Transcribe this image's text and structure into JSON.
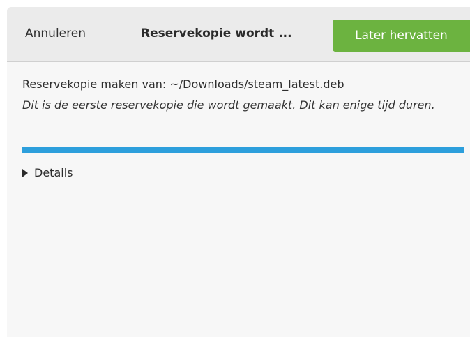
{
  "header": {
    "cancel_label": "Annuleren",
    "title": "Reservekopie wordt ...",
    "resume_label": "Later hervatten"
  },
  "main": {
    "source_line": "Reservekopie maken van: ~/Downloads/steam_latest.deb",
    "note": "Dit is de eerste reservekopie die wordt gemaakt. Dit kan enige tijd duren.",
    "progress_percent": 100,
    "details_label": "Details"
  },
  "colors": {
    "accent_button": "#6cb340",
    "progress": "#2d9fdc"
  },
  "icons": {
    "details_expander": "triangle-right-icon"
  }
}
